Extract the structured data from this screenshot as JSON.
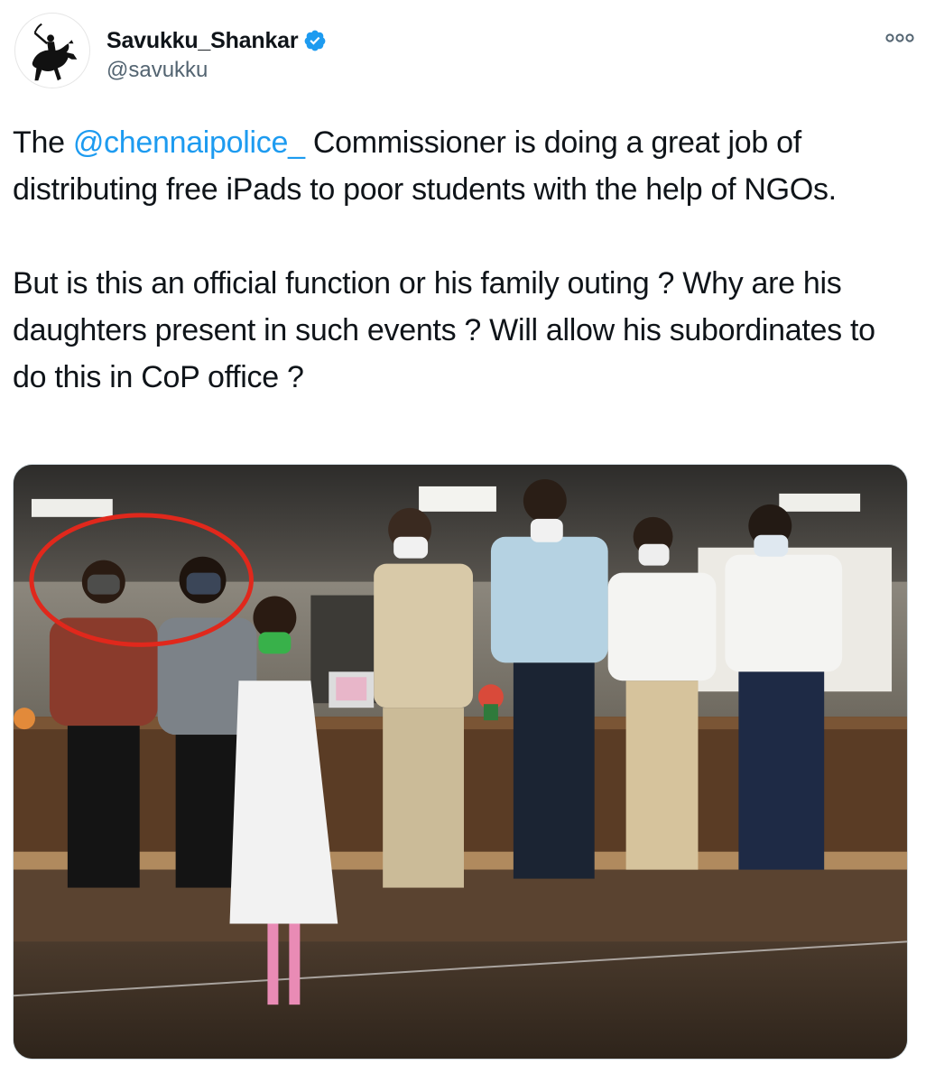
{
  "user": {
    "display_name": "Savukku_Shankar",
    "handle": "@savukku",
    "verified": true,
    "avatar_icon": "horse-rider-silhouette-icon"
  },
  "menu": {
    "icon": "more-options-icon"
  },
  "tweet": {
    "part1_prefix": "The ",
    "mention": "@chennaipolice_",
    "part1_suffix": " Commissioner is doing a great job of distributing free iPads to poor students with the help of NGOs.",
    "part2": "But is this an official function or his family outing ? Why are his daughters present in such events ?  Will allow his subordinates to do this in CoP office ?"
  },
  "media": {
    "type": "photo",
    "highlight_color": "#e0281c"
  },
  "colors": {
    "link": "#1d9bf0",
    "text": "#0f1419",
    "secondary": "#536471",
    "verified_badge": "#1d9bf0"
  }
}
